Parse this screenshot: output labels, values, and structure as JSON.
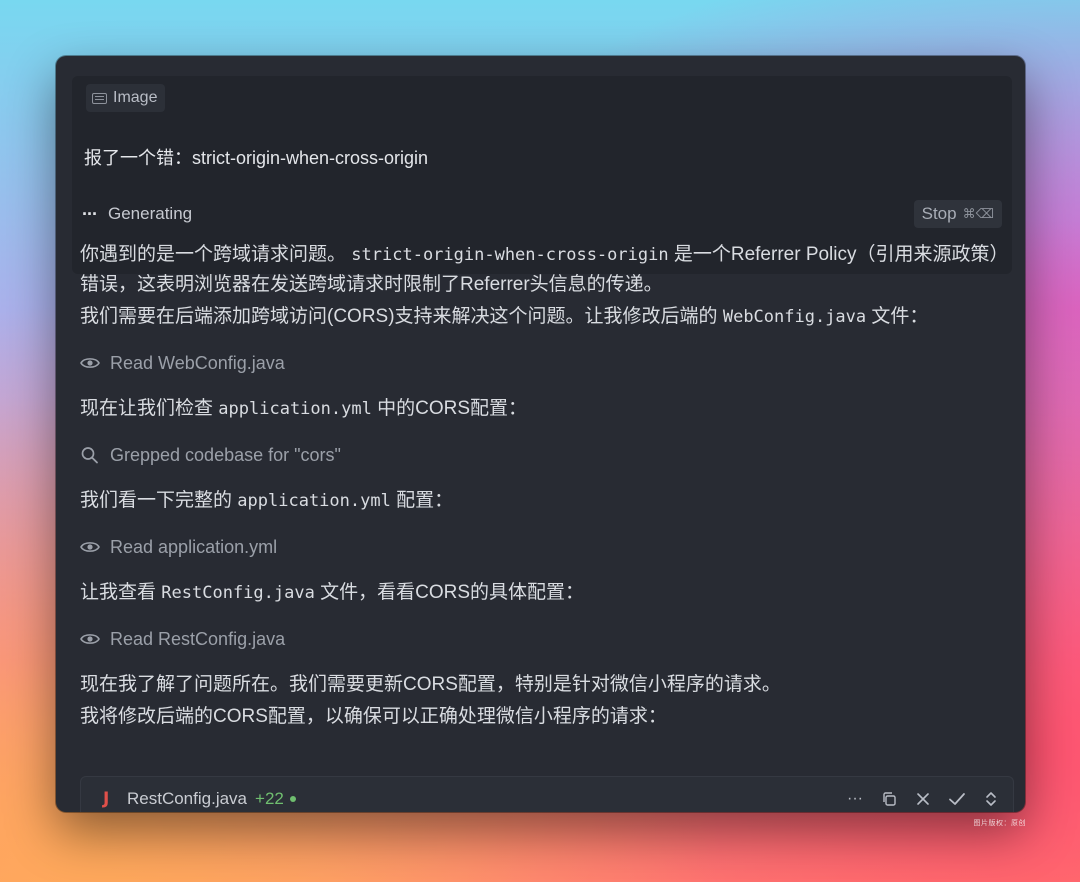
{
  "prompt": {
    "attachment_label": "Image",
    "text": "报了一个错：strict-origin-when-cross-origin",
    "status_label": "Generating",
    "stop_label": "Stop",
    "stop_shortcut": "⌘⌫"
  },
  "messages": {
    "p1_a": "你遇到的是一个跨域请求问题。",
    "p1_code": "strict-origin-when-cross-origin",
    "p1_b": "是一个Referrer Policy（引用来源政策）错误，这表明浏览器在发送跨域请求时限制了Referrer头信息的传递。",
    "p2_a": "我们需要在后端添加跨域访问(CORS)支持来解决这个问题。让我修改后端的",
    "p2_code": "WebConfig.java",
    "p2_b": "文件：",
    "action1": "Read WebConfig.java",
    "p3_a": "现在让我们检查",
    "p3_code": "application.yml",
    "p3_b": "中的CORS配置：",
    "action2": "Grepped codebase for \"cors\"",
    "p4_a": "我们看一下完整的",
    "p4_code": "application.yml",
    "p4_b": "配置：",
    "action3": "Read application.yml",
    "p5_a": "让我查看",
    "p5_code": "RestConfig.java",
    "p5_b": "文件，看看CORS的具体配置：",
    "action4": "Read RestConfig.java",
    "p6": "现在我了解了问题所在。我们需要更新CORS配置，特别是针对微信小程序的请求。",
    "p7": "我将修改后端的CORS配置，以确保可以正确处理微信小程序的请求："
  },
  "file_bar": {
    "icon_letter": "J",
    "file_name": "RestConfig.java",
    "diff": "+22"
  },
  "watermark": "图片版权：原创",
  "colors": {
    "window_bg": "#282b33",
    "prompt_bg": "#22252c",
    "diff_green": "#6fbe6f",
    "java_red": "#e0504a"
  }
}
